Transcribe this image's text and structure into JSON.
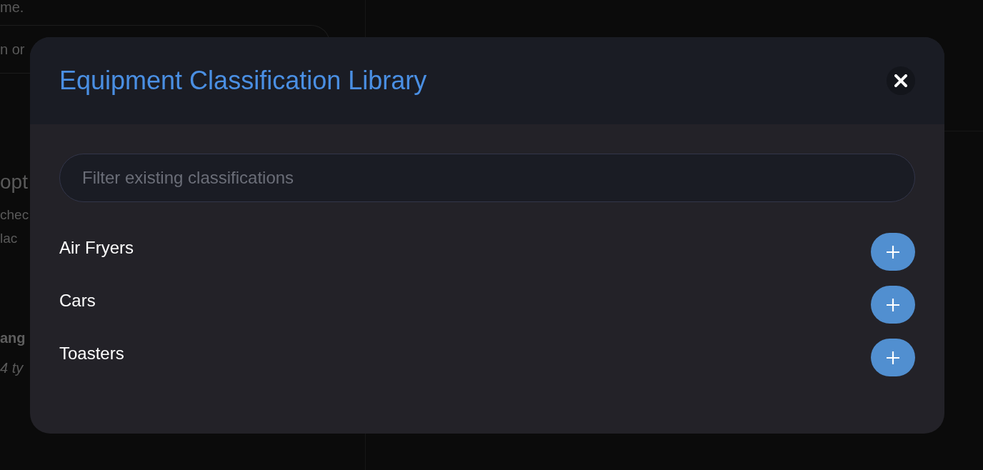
{
  "background": {
    "line_1": "me.",
    "field": {
      "text": "n or"
    },
    "heading": "opt",
    "lines": [
      "chec",
      "lac"
    ],
    "item": {
      "title": "ang",
      "subtitle": "4 ty"
    }
  },
  "dialog": {
    "title": "Equipment Classification Library",
    "filter": {
      "placeholder": "Filter existing classifications"
    },
    "classifications": [
      {
        "name": "Air Fryers"
      },
      {
        "name": "Cars"
      },
      {
        "name": "Toasters"
      }
    ]
  }
}
